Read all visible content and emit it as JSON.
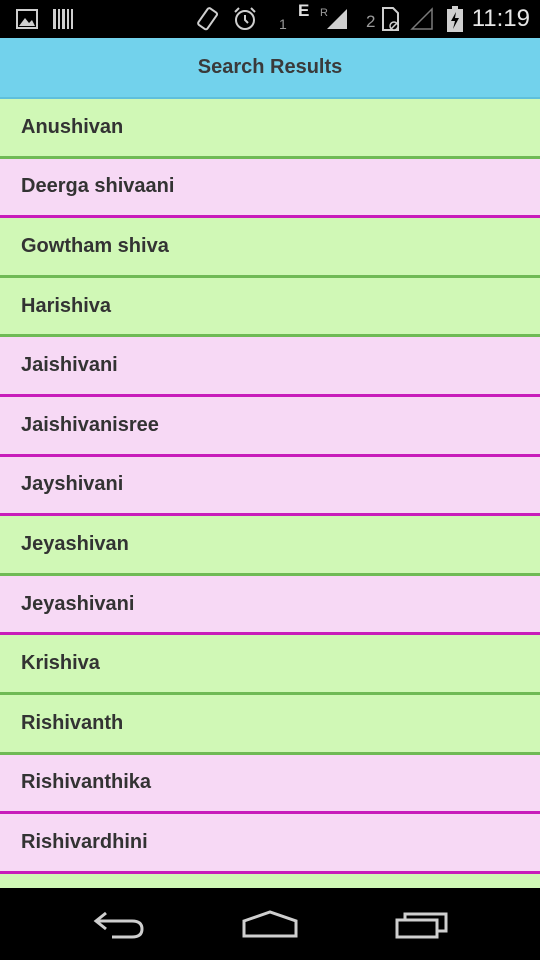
{
  "status_bar": {
    "time": "11:19",
    "sim1_label": "1",
    "network_type": "E",
    "roaming_label": "R",
    "sim2_label": "2",
    "icons": [
      "gallery-icon",
      "barcode-icon",
      "rotate-icon",
      "alarm-icon",
      "signal-icon",
      "sim-card-icon",
      "no-signal-icon",
      "battery-charging-icon"
    ]
  },
  "header": {
    "title": "Search Results",
    "color": "#72d2ec"
  },
  "colors": {
    "green_row": "#d0f8b6",
    "green_border": "#6fba55",
    "pink_row": "#f7d9f5",
    "pink_border": "#c81cba"
  },
  "results": {
    "items": [
      {
        "label": "Anushivan",
        "style": "green"
      },
      {
        "label": "Deerga shivaani",
        "style": "pink"
      },
      {
        "label": "Gowtham shiva",
        "style": "green"
      },
      {
        "label": "Harishiva",
        "style": "green"
      },
      {
        "label": "Jaishivani",
        "style": "pink"
      },
      {
        "label": "Jaishivanisree",
        "style": "pink"
      },
      {
        "label": "Jayshivani",
        "style": "pink"
      },
      {
        "label": "Jeyashivan",
        "style": "green"
      },
      {
        "label": "Jeyashivani",
        "style": "pink"
      },
      {
        "label": "Krishiva",
        "style": "green"
      },
      {
        "label": "Rishivanth",
        "style": "green"
      },
      {
        "label": "Rishivanthika",
        "style": "pink"
      },
      {
        "label": "Rishivardhini",
        "style": "pink"
      },
      {
        "label": "",
        "style": "green"
      }
    ]
  },
  "nav_bar": {
    "icons": [
      "back-icon",
      "home-icon",
      "recent-apps-icon"
    ]
  }
}
